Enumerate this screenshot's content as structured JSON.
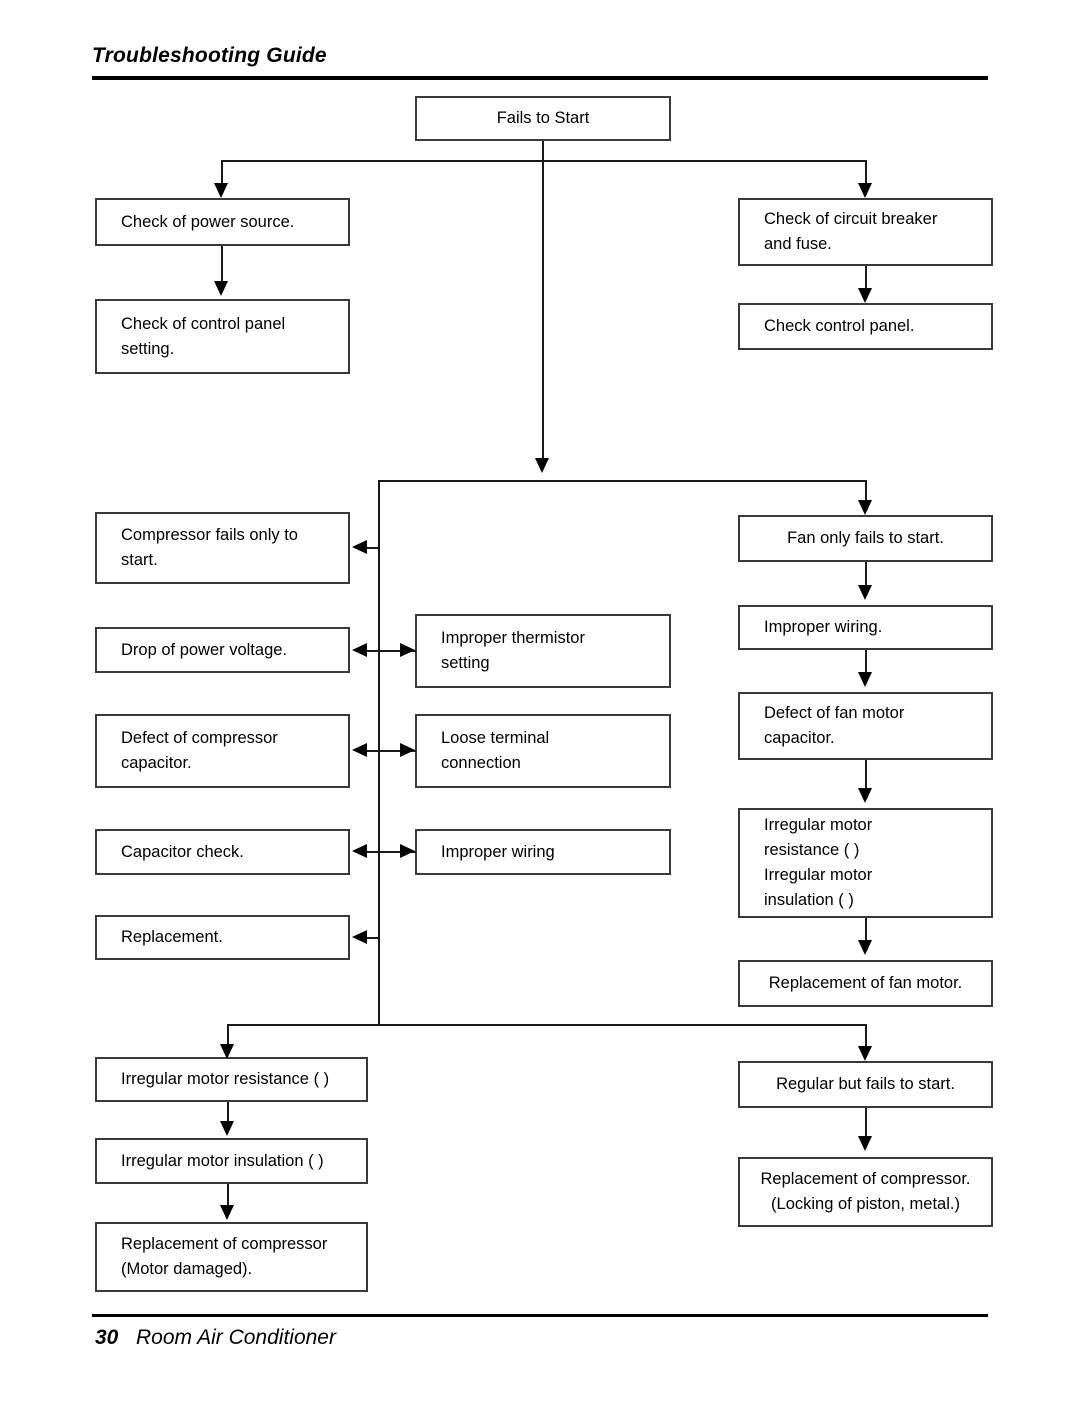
{
  "header": {
    "title": "Troubleshooting Guide"
  },
  "footer": {
    "page_number": "30",
    "document_name": "Room Air Conditioner"
  },
  "chart_data": {
    "type": "diagram",
    "title": "Fails to Start troubleshooting flowchart",
    "nodes": [
      {
        "id": "n1",
        "label": "Fails to Start"
      },
      {
        "id": "n2",
        "label": "Check of power source."
      },
      {
        "id": "n3",
        "label": "Check of control panel\nsetting."
      },
      {
        "id": "n4",
        "label": "Check of circuit breaker\nand fuse."
      },
      {
        "id": "n5",
        "label": "Check control panel."
      },
      {
        "id": "n6",
        "label": "Compressor fails only to\nstart."
      },
      {
        "id": "n7",
        "label": "Drop of power voltage."
      },
      {
        "id": "n8",
        "label": "Defect of compressor\ncapacitor."
      },
      {
        "id": "n9",
        "label": "Capacitor check."
      },
      {
        "id": "n10",
        "label": "Replacement."
      },
      {
        "id": "n11",
        "label": "Improper thermistor\nsetting"
      },
      {
        "id": "n12",
        "label": "Loose terminal\nconnection"
      },
      {
        "id": "n13",
        "label": "Improper wiring"
      },
      {
        "id": "n14",
        "label": "Fan only fails to start."
      },
      {
        "id": "n15",
        "label": "Improper wiring."
      },
      {
        "id": "n16",
        "label": "Defect of fan motor\ncapacitor."
      },
      {
        "id": "n17",
        "label": "Irregular motor\nresistance (   )\nIrregular motor\ninsulation (   )"
      },
      {
        "id": "n18",
        "label": "Replacement of fan motor."
      },
      {
        "id": "n19",
        "label": "Irregular motor resistance (   )"
      },
      {
        "id": "n20",
        "label": "Irregular motor insulation (   )"
      },
      {
        "id": "n21",
        "label": "Replacement of compressor\n(Motor damaged)."
      },
      {
        "id": "n22",
        "label": "Regular but fails to start."
      },
      {
        "id": "n23",
        "label": "Replacement of compressor.\n(Locking of piston, metal.)"
      }
    ],
    "edges": [
      {
        "from": "n1",
        "to": "n2",
        "kind": "branch-down"
      },
      {
        "from": "n1",
        "to": "n4",
        "kind": "branch-down"
      },
      {
        "from": "n2",
        "to": "n3",
        "kind": "down"
      },
      {
        "from": "n4",
        "to": "n5",
        "kind": "down"
      },
      {
        "from": "n1",
        "to": "spine",
        "kind": "down"
      },
      {
        "from": "spine",
        "to": "n14",
        "kind": "branch-down"
      },
      {
        "from": "spine",
        "to": "n6",
        "kind": "left"
      },
      {
        "from": "spine",
        "to": "n7",
        "kind": "bidirectional"
      },
      {
        "from": "n7",
        "to": "n11",
        "kind": "bidirectional"
      },
      {
        "from": "spine",
        "to": "n8",
        "kind": "bidirectional"
      },
      {
        "from": "n8",
        "to": "n12",
        "kind": "bidirectional"
      },
      {
        "from": "spine",
        "to": "n9",
        "kind": "bidirectional"
      },
      {
        "from": "n9",
        "to": "n13",
        "kind": "bidirectional"
      },
      {
        "from": "spine",
        "to": "n10",
        "kind": "left"
      },
      {
        "from": "n14",
        "to": "n15",
        "kind": "down"
      },
      {
        "from": "n15",
        "to": "n16",
        "kind": "down"
      },
      {
        "from": "n16",
        "to": "n17",
        "kind": "down"
      },
      {
        "from": "n17",
        "to": "n18",
        "kind": "down"
      },
      {
        "from": "spine",
        "to": "n19",
        "kind": "branch-down"
      },
      {
        "from": "spine",
        "to": "n22",
        "kind": "branch-down"
      },
      {
        "from": "n19",
        "to": "n20",
        "kind": "down"
      },
      {
        "from": "n20",
        "to": "n21",
        "kind": "down"
      },
      {
        "from": "n22",
        "to": "n23",
        "kind": "down"
      }
    ]
  }
}
